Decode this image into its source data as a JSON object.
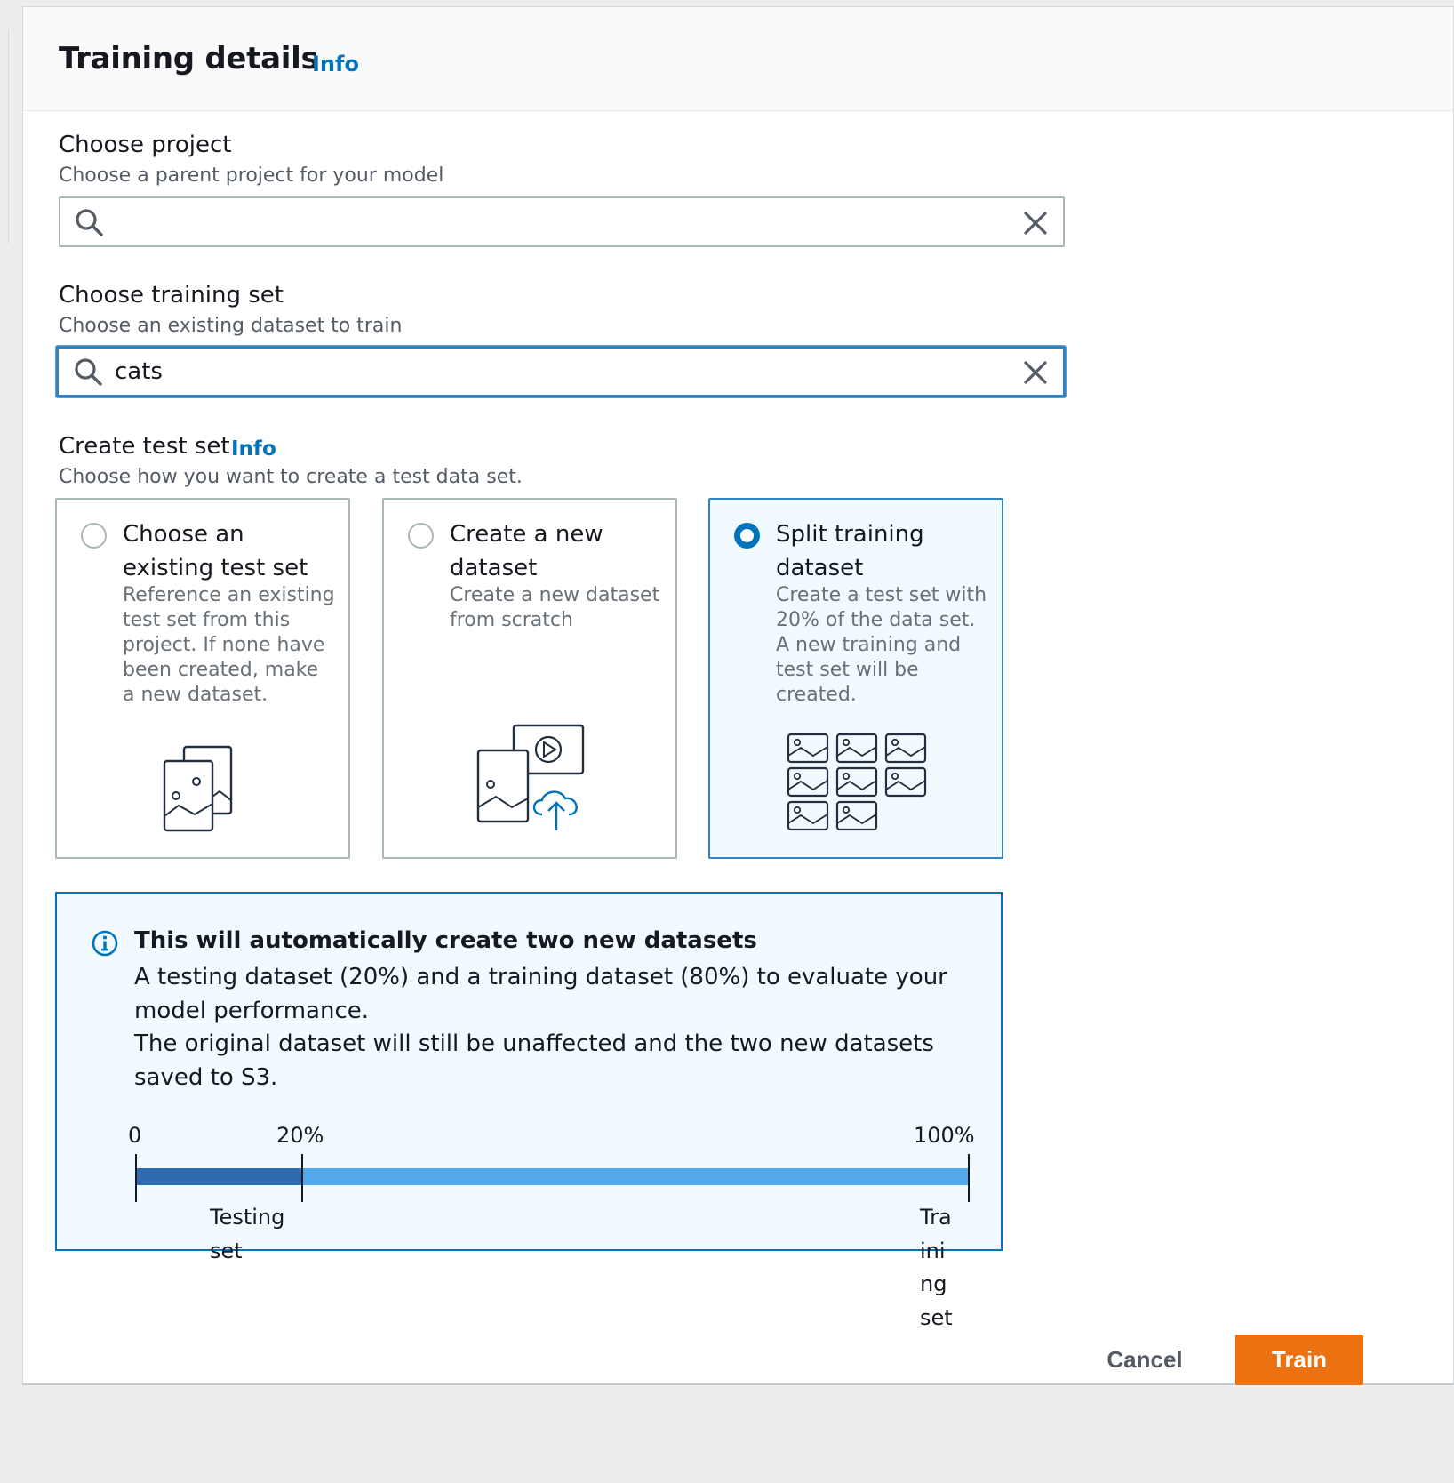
{
  "header": {
    "title": "Training details",
    "info_label": "Info"
  },
  "project": {
    "label": "Choose project",
    "description": "Choose a parent project for your model",
    "value": ""
  },
  "training_set": {
    "label": "Choose training set",
    "description": "Choose an existing dataset to train",
    "value": "cats"
  },
  "test_set": {
    "label": "Create test set",
    "info_label": "Info",
    "description": "Choose how you want to create a test data set.",
    "options": [
      {
        "title": "Choose an existing test set",
        "description": "Reference an existing test set from this project. If none have been created, make a new dataset.",
        "selected": false,
        "icon": "stacked-images-icon"
      },
      {
        "title": "Create a new dataset",
        "description": "Create a new dataset from scratch",
        "selected": false,
        "icon": "media-upload-icon"
      },
      {
        "title": "Split training dataset",
        "description": "Create a test set with 20% of the data set. A new training and test set will be created.",
        "selected": true,
        "icon": "image-grid-icon"
      }
    ]
  },
  "alert": {
    "icon": "info-icon",
    "title": "This will automatically create two new datasets",
    "body_line1": "A testing dataset (20%) and a training dataset (80%) to evaluate your model performance.",
    "body_line2": "The original dataset will still be unaffected and the two new datasets saved to S3.",
    "split": {
      "tick_start": "0",
      "tick_split": "20%",
      "tick_end": "100%",
      "test_fraction": 0.2,
      "testing_label": "Testing set",
      "training_label": "Training set"
    }
  },
  "actions": {
    "cancel": "Cancel",
    "train": "Train"
  },
  "colors": {
    "accent": "#0073bb",
    "primary_button": "#ec7211",
    "test_bar": "#2e6bb0",
    "train_bar": "#54a8ec"
  }
}
